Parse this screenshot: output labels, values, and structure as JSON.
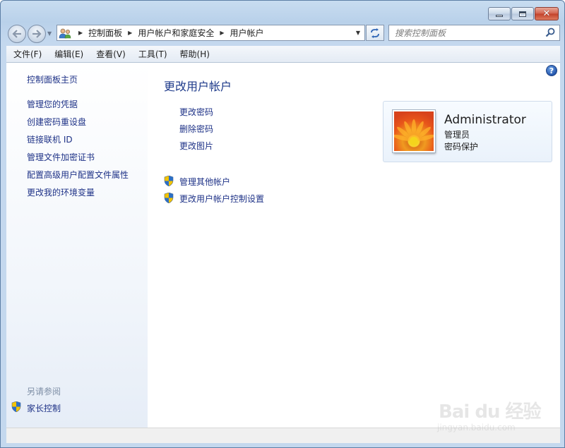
{
  "window": {
    "caption": {
      "minimize": "–",
      "maximize": "□",
      "close": "✕"
    }
  },
  "nav": {
    "back_icon": "back-arrow-icon",
    "forward_icon": "forward-arrow-icon",
    "breadcrumbs": [
      "控制面板",
      "用户帐户和家庭安全",
      "用户帐户"
    ],
    "search_placeholder": "搜索控制面板"
  },
  "menu": [
    "文件(F)",
    "编辑(E)",
    "查看(V)",
    "工具(T)",
    "帮助(H)"
  ],
  "sidebar": {
    "home": "控制面板主页",
    "links": [
      "管理您的凭据",
      "创建密码重设盘",
      "链接联机 ID",
      "管理文件加密证书",
      "配置高级用户配置文件属性",
      "更改我的环境变量"
    ],
    "see_also_title": "另请参阅",
    "see_also": [
      "家长控制"
    ]
  },
  "main": {
    "title": "更改用户帐户",
    "tasks": [
      "更改密码",
      "删除密码",
      "更改图片"
    ],
    "shield_tasks": [
      "管理其他帐户",
      "更改用户帐户控制设置"
    ],
    "help": "?"
  },
  "user": {
    "name": "Administrator",
    "role": "管理员",
    "status": "密码保护"
  },
  "watermark": {
    "main": "Bai du 经验",
    "sub": "jingyan.baidu.com"
  }
}
